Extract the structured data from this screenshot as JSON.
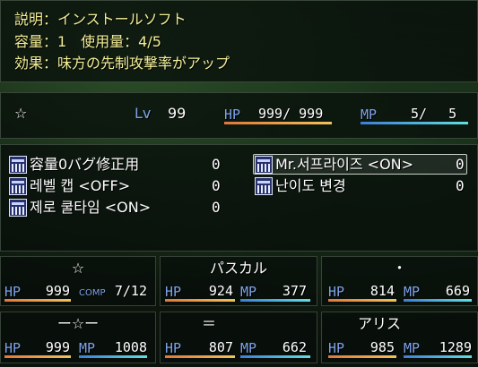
{
  "help": {
    "line1": "説明：インストールソフト",
    "line2": "容量：1　使用量：4/5",
    "line3": "効果：味方の先制攻撃率がアップ"
  },
  "status": {
    "name": "☆",
    "lv_label": "Lv",
    "lv": "99",
    "hp_label": "HP",
    "hp": "999/ 999",
    "mp_label": "MP",
    "mp": "5/　 5"
  },
  "software": [
    {
      "name": "容量0バグ修正用",
      "count": "0"
    },
    {
      "name": "레벨 캡 <OFF>",
      "count": "0"
    },
    {
      "name": "제로 쿨타임 <ON>",
      "count": "0"
    },
    {
      "name": "Mr.서프라이즈 <ON>",
      "count": "0"
    },
    {
      "name": "난이도 변경",
      "count": "0"
    }
  ],
  "party": [
    {
      "name": "☆",
      "hp_label": "HP",
      "hp": "999",
      "sub_label": "COMP",
      "sub": "7/12"
    },
    {
      "name": "パスカル",
      "hp_label": "HP",
      "hp": "924",
      "sub_label": "MP",
      "sub": "377"
    },
    {
      "name": "・",
      "hp_label": "HP",
      "hp": "814",
      "sub_label": "MP",
      "sub": "669"
    },
    {
      "name": "ー☆ー",
      "hp_label": "HP",
      "hp": "999",
      "sub_label": "MP",
      "sub": "1008"
    },
    {
      "name": "＝",
      "hp_label": "HP",
      "hp": "807",
      "sub_label": "MP",
      "sub": "662"
    },
    {
      "name": "アリス",
      "hp_label": "HP",
      "hp": "985",
      "sub_label": "MP",
      "sub": "1289"
    }
  ],
  "colors": {
    "hp_bar": "#e2783a",
    "mp_bar": "#3e7fd8",
    "help_text": "#f3ef97"
  }
}
